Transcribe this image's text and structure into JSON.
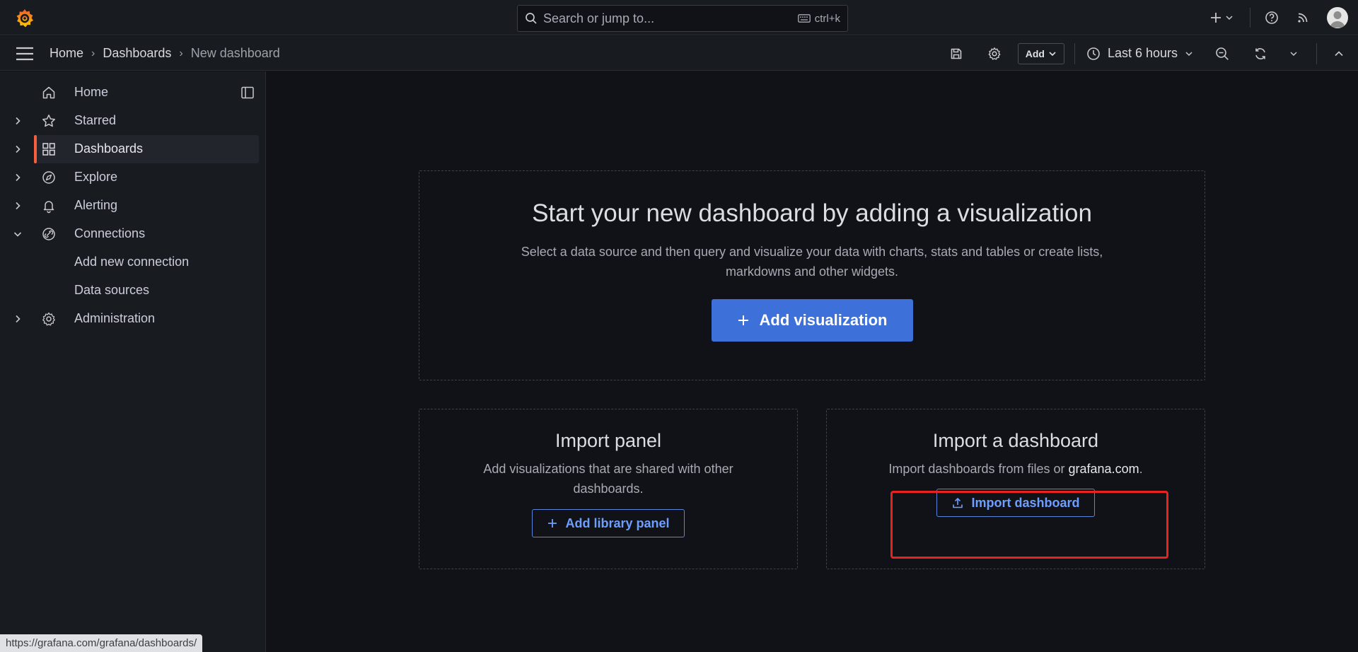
{
  "topbar": {
    "search_placeholder": "Search or jump to...",
    "search_shortcut": "ctrl+k"
  },
  "breadcrumb": {
    "items": [
      "Home",
      "Dashboards"
    ],
    "current": "New dashboard"
  },
  "toolbar": {
    "add_label": "Add",
    "time_range": "Last 6 hours"
  },
  "sidebar": {
    "items": [
      {
        "label": "Home",
        "icon": "home-icon"
      },
      {
        "label": "Starred",
        "icon": "star-icon"
      },
      {
        "label": "Dashboards",
        "icon": "apps-icon"
      },
      {
        "label": "Explore",
        "icon": "compass-icon"
      },
      {
        "label": "Alerting",
        "icon": "bell-icon"
      },
      {
        "label": "Connections",
        "icon": "link-icon"
      },
      {
        "label": "Administration",
        "icon": "gear-icon"
      }
    ],
    "sub_items": [
      "Add new connection",
      "Data sources"
    ]
  },
  "main": {
    "title": "Start your new dashboard by adding a visualization",
    "description": "Select a data source and then query and visualize your data with charts, stats and tables or create lists, markdowns and other widgets.",
    "add_visualization": "Add visualization",
    "import_panel": {
      "title": "Import panel",
      "description": "Add visualizations that are shared with other dashboards.",
      "button": "Add library panel"
    },
    "import_dashboard": {
      "title": "Import a dashboard",
      "description_prefix": "Import dashboards from files or ",
      "link": "grafana.com",
      "description_suffix": ".",
      "button": "Import dashboard"
    }
  },
  "status_url": "https://grafana.com/grafana/dashboards/",
  "colors": {
    "accent": "#f55f3e",
    "primary": "#3d71d9",
    "highlight": "#e8231e"
  }
}
